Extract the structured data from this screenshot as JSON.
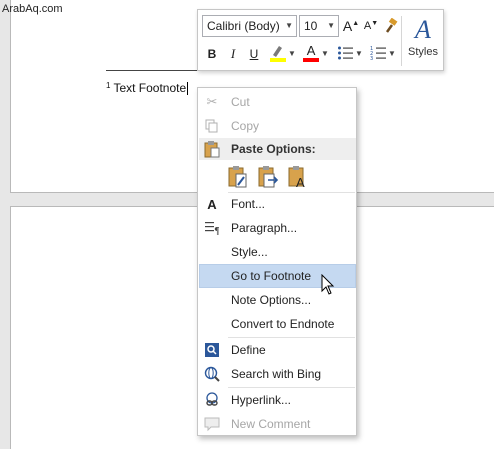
{
  "watermark": "ArabAq.com",
  "document": {
    "footnote_mark": "1",
    "footnote_text": "Text Footnote"
  },
  "mini_toolbar": {
    "font_name": "Calibri (Body)",
    "font_size": "10",
    "styles_label": "Styles",
    "bold": "B",
    "italic": "I",
    "underline": "U",
    "font_color_glyph": "A",
    "grow_font_glyph": "A",
    "shrink_font_glyph": "A",
    "highlight_color": "#ffff00",
    "font_color": "#ff0000"
  },
  "context_menu": {
    "cut": "Cut",
    "copy": "Copy",
    "paste_options": "Paste Options:",
    "font": "Font...",
    "paragraph": "Paragraph...",
    "style": "Style...",
    "go_to_footnote": "Go to Footnote",
    "note_options": "Note Options...",
    "convert_to_endnote": "Convert to Endnote",
    "define": "Define",
    "search_with_bing": "Search with Bing",
    "hyperlink": "Hyperlink...",
    "new_comment": "New Comment",
    "highlight_color": "#c5d9f1"
  }
}
